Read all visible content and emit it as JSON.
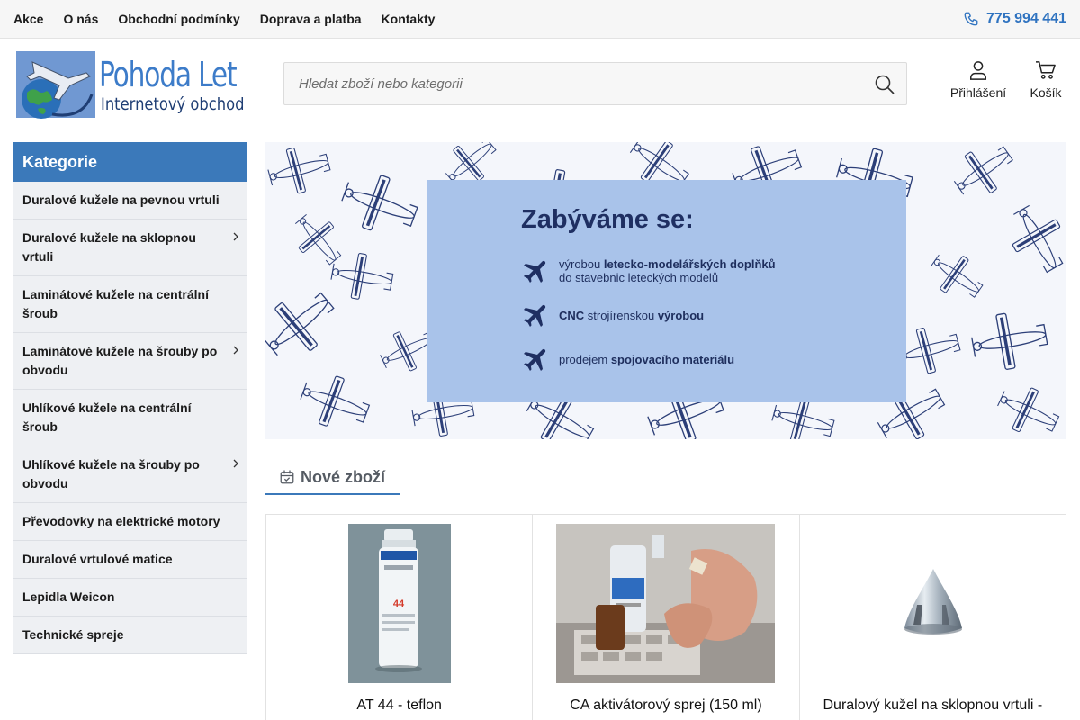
{
  "topnav": {
    "items": [
      "Akce",
      "O nás",
      "Obchodní podmínky",
      "Doprava a platba",
      "Kontakty"
    ],
    "phone": "775 994 441"
  },
  "header": {
    "logo_title": "Pohoda Let",
    "logo_subtitle": "Internetový obchod",
    "search_placeholder": "Hledat zboží nebo kategorii",
    "login_label": "Přihlášení",
    "cart_label": "Košík"
  },
  "sidebar": {
    "title": "Kategorie",
    "items": [
      {
        "label": "Duralové kužele na pevnou vrtuli",
        "has_children": false
      },
      {
        "label": "Duralové kužele na sklopnou vrtuli",
        "has_children": true
      },
      {
        "label": "Laminátové kužele na centrální šroub",
        "has_children": false
      },
      {
        "label": "Laminátové kužele na šrouby po obvodu",
        "has_children": true
      },
      {
        "label": "Uhlíkové kužele na centrální šroub",
        "has_children": false
      },
      {
        "label": "Uhlíkové kužele na šrouby po obvodu",
        "has_children": true
      },
      {
        "label": "Převodovky na elektrické motory",
        "has_children": false
      },
      {
        "label": "Duralové vrtulové matice",
        "has_children": false
      },
      {
        "label": "Lepidla Weicon",
        "has_children": false
      },
      {
        "label": "Technické spreje",
        "has_children": false
      }
    ]
  },
  "banner": {
    "title": "Zabýváme se:",
    "points": [
      {
        "pre": "výrobou ",
        "bold": "letecko-modelářských doplňků",
        "post": "",
        "line2": "do stavebnic leteckých modelů"
      },
      {
        "pre": "",
        "bold": "CNC",
        "post": " strojírenskou ",
        "bold2": "výrobou"
      },
      {
        "pre": "prodejem ",
        "bold": "spojovacího materiálu",
        "post": ""
      }
    ]
  },
  "new_items": {
    "tab_label": "Nové zboží",
    "products": [
      {
        "name": "AT 44 - teflon"
      },
      {
        "name": "CA aktivátorový sprej (150 ml)"
      },
      {
        "name": "Duralový kužel na sklopnou vrtuli -"
      }
    ]
  },
  "colors": {
    "accent": "#3b79ba",
    "phone": "#2f73c0",
    "banner_box": "#a9c3ea",
    "sidebar_bg": "#eef0f3"
  },
  "icons": {
    "phone": "phone-icon",
    "search": "search-icon",
    "login": "user-icon",
    "cart": "cart-icon",
    "chevron": "chevron-right-icon",
    "calendar": "calendar-check-icon",
    "plane": "airplane-icon"
  }
}
